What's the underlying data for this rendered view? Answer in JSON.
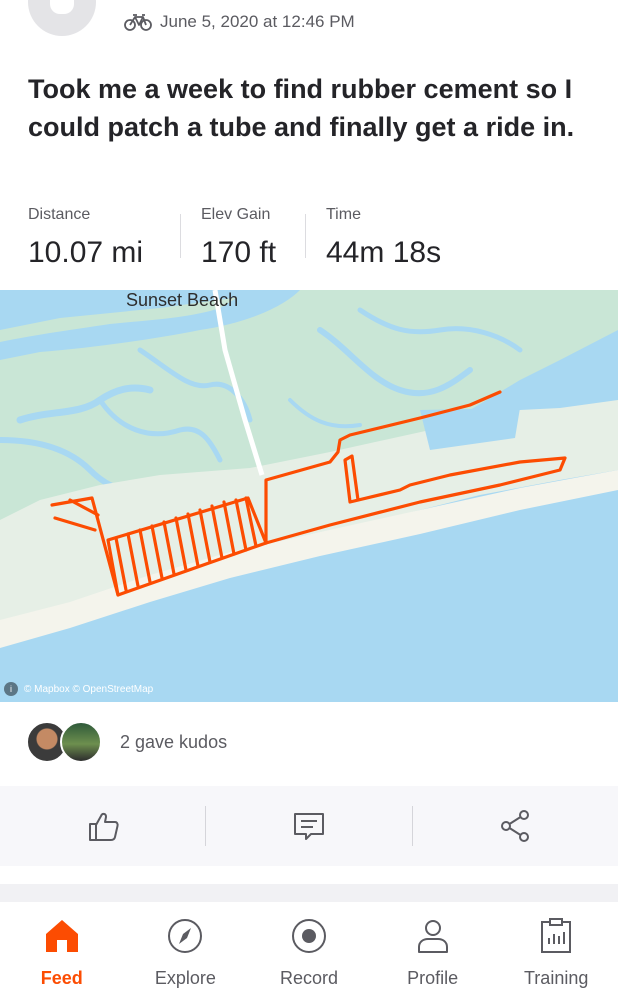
{
  "post": {
    "date": "June 5, 2020 at 12:46 PM",
    "activity_icon": "bike-icon",
    "title": "Took me a week to find rubber cement so I could patch a tube and finally get a ride in."
  },
  "stats": [
    {
      "label": "Distance",
      "value": "10.07 mi"
    },
    {
      "label": "Elev Gain",
      "value": "170 ft"
    },
    {
      "label": "Time",
      "value": "44m 18s"
    }
  ],
  "map": {
    "place_label": "Sunset Beach",
    "attribution": "© Mapbox © OpenStreetMap",
    "route_color": "#fc4c02",
    "water_color": "#a8d8f2",
    "land_color": "#c9e6d6"
  },
  "kudos": {
    "text": "2 gave kudos"
  },
  "actions": [
    {
      "name": "kudos",
      "icon": "thumbs-up-icon"
    },
    {
      "name": "comment",
      "icon": "comment-icon"
    },
    {
      "name": "share",
      "icon": "share-icon"
    }
  ],
  "tabs": [
    {
      "label": "Feed",
      "icon": "home-icon",
      "active": true
    },
    {
      "label": "Explore",
      "icon": "compass-icon",
      "active": false
    },
    {
      "label": "Record",
      "icon": "record-icon",
      "active": false
    },
    {
      "label": "Profile",
      "icon": "profile-icon",
      "active": false
    },
    {
      "label": "Training",
      "icon": "training-icon",
      "active": false
    }
  ],
  "colors": {
    "accent": "#fc4c02",
    "text_primary": "#242428",
    "text_secondary": "#5b5b61"
  }
}
